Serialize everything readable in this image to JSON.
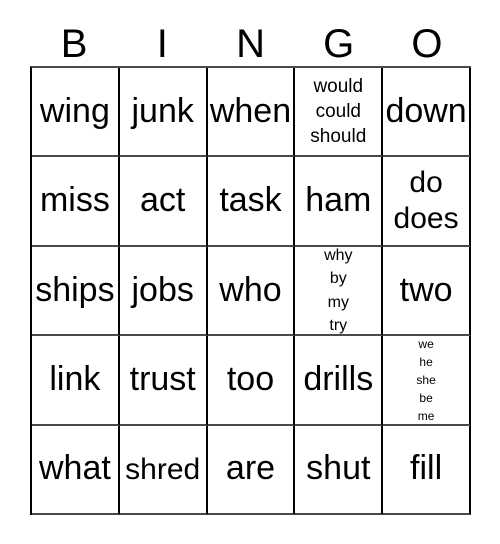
{
  "card": {
    "header": {
      "letters": [
        "B",
        "I",
        "N",
        "G",
        "O"
      ]
    },
    "grid": {
      "rows": 5,
      "columns": 5,
      "border_color": "#000000",
      "background_color": "#ffffff",
      "text_color": "#000000",
      "cells": [
        [
          {
            "text": "wing",
            "lines": 1,
            "size": "size-1"
          },
          {
            "text": "junk",
            "lines": 1,
            "size": "size-1"
          },
          {
            "text": "when",
            "lines": 1,
            "size": "size-1"
          },
          {
            "text": "would\ncould\nshould",
            "lines": 3,
            "size": "size-3"
          },
          {
            "text": "down",
            "lines": 1,
            "size": "size-1"
          }
        ],
        [
          {
            "text": "miss",
            "lines": 1,
            "size": "size-1"
          },
          {
            "text": "act",
            "lines": 1,
            "size": "size-1"
          },
          {
            "text": "task",
            "lines": 1,
            "size": "size-1"
          },
          {
            "text": "ham",
            "lines": 1,
            "size": "size-1"
          },
          {
            "text": "do\ndoes",
            "lines": 2,
            "size": "size-2"
          }
        ],
        [
          {
            "text": "ships",
            "lines": 1,
            "size": "size-1"
          },
          {
            "text": "jobs",
            "lines": 1,
            "size": "size-1"
          },
          {
            "text": "who",
            "lines": 1,
            "size": "size-1"
          },
          {
            "text": "why\nby\nmy\ntry",
            "lines": 4,
            "size": "size-4"
          },
          {
            "text": "two",
            "lines": 1,
            "size": "size-1"
          }
        ],
        [
          {
            "text": "link",
            "lines": 1,
            "size": "size-1"
          },
          {
            "text": "trust",
            "lines": 1,
            "size": "size-1"
          },
          {
            "text": "too",
            "lines": 1,
            "size": "size-1"
          },
          {
            "text": "drills",
            "lines": 1,
            "size": "size-1"
          },
          {
            "text": "we\nhe\nshe\nbe\nme",
            "lines": 5,
            "size": "size-5"
          }
        ],
        [
          {
            "text": "what",
            "lines": 1,
            "size": "size-1"
          },
          {
            "text": "shred",
            "lines": 1,
            "size": "size-1-narrow"
          },
          {
            "text": "are",
            "lines": 1,
            "size": "size-1"
          },
          {
            "text": "shut",
            "lines": 1,
            "size": "size-1"
          },
          {
            "text": "fill",
            "lines": 1,
            "size": "size-1"
          }
        ]
      ]
    }
  }
}
